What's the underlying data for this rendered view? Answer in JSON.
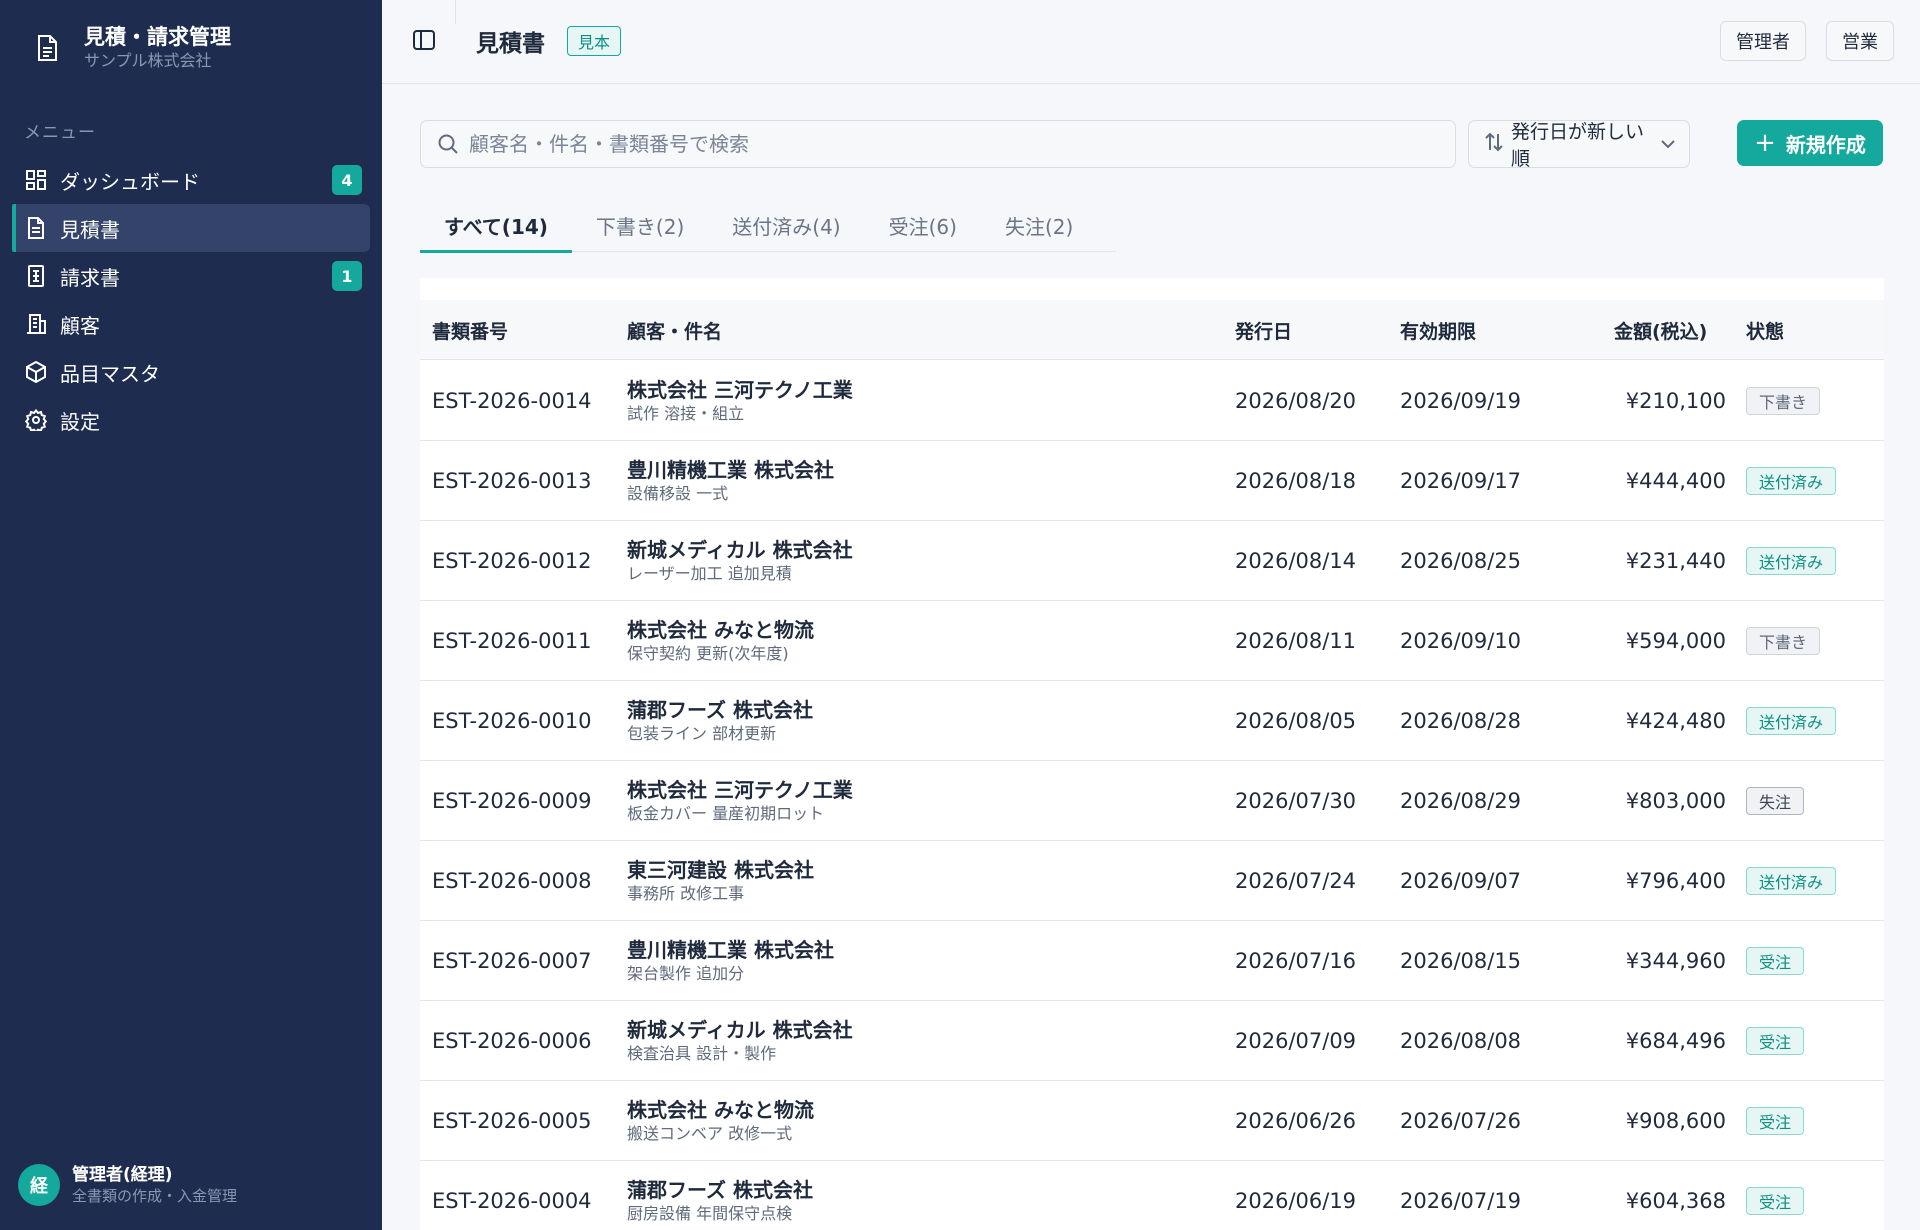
{
  "app": {
    "title": "見積・請求管理",
    "company": "サンプル株式会社"
  },
  "sidebar": {
    "menu_heading": "メニュー",
    "items": [
      {
        "label": "ダッシュボード",
        "badge": "4"
      },
      {
        "label": "見積書",
        "badge": ""
      },
      {
        "label": "請求書",
        "badge": "1"
      },
      {
        "label": "顧客",
        "badge": ""
      },
      {
        "label": "品目マスタ",
        "badge": ""
      },
      {
        "label": "設定",
        "badge": ""
      }
    ],
    "user": {
      "avatar": "経",
      "name": "管理者(経理)",
      "role": "全書類の作成・入金管理"
    }
  },
  "header": {
    "title": "見積書",
    "badge": "見本",
    "role_buttons": [
      "管理者",
      "営業"
    ]
  },
  "search": {
    "placeholder": "顧客名・件名・書類番号で検索",
    "value": ""
  },
  "sort": {
    "label": "発行日が新しい順"
  },
  "new_button": {
    "label": "新規作成"
  },
  "tabs": [
    "すべて(14)",
    "下書き(2)",
    "送付済み(4)",
    "受注(6)",
    "失注(2)"
  ],
  "table": {
    "headers": [
      "書類番号",
      "顧客・件名",
      "発行日",
      "有効期限",
      "金額(税込)",
      "状態"
    ],
    "rows": [
      {
        "id": "EST-2026-0014",
        "customer": "株式会社 三河テクノ工業",
        "subject": "試作 溶接・組立",
        "issued": "2026/08/20",
        "valid": "2026/09/19",
        "amount": "¥210,100",
        "status": "下書き",
        "status_type": "draft"
      },
      {
        "id": "EST-2026-0013",
        "customer": "豊川精機工業 株式会社",
        "subject": "設備移設 一式",
        "issued": "2026/08/18",
        "valid": "2026/09/17",
        "amount": "¥444,400",
        "status": "送付済み",
        "status_type": "sent"
      },
      {
        "id": "EST-2026-0012",
        "customer": "新城メディカル 株式会社",
        "subject": "レーザー加工 追加見積",
        "issued": "2026/08/14",
        "valid": "2026/08/25",
        "amount": "¥231,440",
        "status": "送付済み",
        "status_type": "sent"
      },
      {
        "id": "EST-2026-0011",
        "customer": "株式会社 みなと物流",
        "subject": "保守契約 更新(次年度)",
        "issued": "2026/08/11",
        "valid": "2026/09/10",
        "amount": "¥594,000",
        "status": "下書き",
        "status_type": "draft"
      },
      {
        "id": "EST-2026-0010",
        "customer": "蒲郡フーズ 株式会社",
        "subject": "包装ライン 部材更新",
        "issued": "2026/08/05",
        "valid": "2026/08/28",
        "amount": "¥424,480",
        "status": "送付済み",
        "status_type": "sent"
      },
      {
        "id": "EST-2026-0009",
        "customer": "株式会社 三河テクノ工業",
        "subject": "板金カバー 量産初期ロット",
        "issued": "2026/07/30",
        "valid": "2026/08/29",
        "amount": "¥803,000",
        "status": "失注",
        "status_type": "lost"
      },
      {
        "id": "EST-2026-0008",
        "customer": "東三河建設 株式会社",
        "subject": "事務所 改修工事",
        "issued": "2026/07/24",
        "valid": "2026/09/07",
        "amount": "¥796,400",
        "status": "送付済み",
        "status_type": "sent"
      },
      {
        "id": "EST-2026-0007",
        "customer": "豊川精機工業 株式会社",
        "subject": "架台製作 追加分",
        "issued": "2026/07/16",
        "valid": "2026/08/15",
        "amount": "¥344,960",
        "status": "受注",
        "status_type": "won"
      },
      {
        "id": "EST-2026-0006",
        "customer": "新城メディカル 株式会社",
        "subject": "検査治具 設計・製作",
        "issued": "2026/07/09",
        "valid": "2026/08/08",
        "amount": "¥684,496",
        "status": "受注",
        "status_type": "won"
      },
      {
        "id": "EST-2026-0005",
        "customer": "株式会社 みなと物流",
        "subject": "搬送コンベア 改修一式",
        "issued": "2026/06/26",
        "valid": "2026/07/26",
        "amount": "¥908,600",
        "status": "受注",
        "status_type": "won"
      },
      {
        "id": "EST-2026-0004",
        "customer": "蒲郡フーズ 株式会社",
        "subject": "厨房設備 年間保守点検",
        "issued": "2026/06/19",
        "valid": "2026/07/19",
        "amount": "¥604,368",
        "status": "受注",
        "status_type": "won"
      }
    ]
  },
  "colors": {
    "sidebar_bg": "#1e2d4f",
    "accent": "#14a99c",
    "page_bg": "#f5f7fa"
  }
}
